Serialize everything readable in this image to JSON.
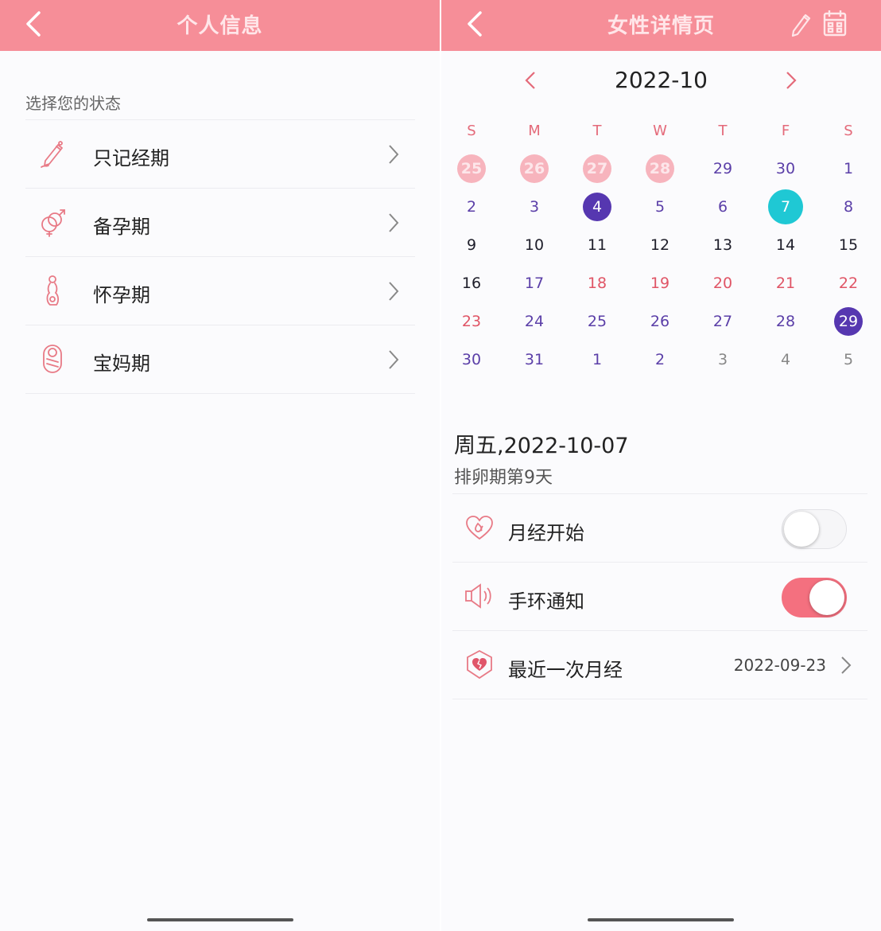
{
  "left": {
    "title": "个人信息",
    "section_label": "选择您的状态",
    "items": [
      {
        "label": "只记经期",
        "icon": "pencil-icon"
      },
      {
        "label": "备孕期",
        "icon": "gender-rings-icon"
      },
      {
        "label": "怀孕期",
        "icon": "pregnant-icon"
      },
      {
        "label": "宝妈期",
        "icon": "baby-icon"
      }
    ]
  },
  "right": {
    "title": "女性详情页",
    "month": "2022-10",
    "weekdays": [
      "S",
      "M",
      "T",
      "W",
      "T",
      "F",
      "S"
    ],
    "weeks": [
      [
        {
          "d": "25",
          "s": "period"
        },
        {
          "d": "26",
          "s": "period"
        },
        {
          "d": "27",
          "s": "period"
        },
        {
          "d": "28",
          "s": "period"
        },
        {
          "d": "29",
          "s": "purple"
        },
        {
          "d": "30",
          "s": "purple"
        },
        {
          "d": "1",
          "s": "purple"
        }
      ],
      [
        {
          "d": "2",
          "s": "purple"
        },
        {
          "d": "3",
          "s": "purple"
        },
        {
          "d": "4",
          "s": "sel-purple"
        },
        {
          "d": "5",
          "s": "purple"
        },
        {
          "d": "6",
          "s": "purple"
        },
        {
          "d": "7",
          "s": "sel-cyan"
        },
        {
          "d": "8",
          "s": "purple"
        }
      ],
      [
        {
          "d": "9",
          "s": "dark"
        },
        {
          "d": "10",
          "s": "dark"
        },
        {
          "d": "11",
          "s": "dark"
        },
        {
          "d": "12",
          "s": "dark"
        },
        {
          "d": "13",
          "s": "dark"
        },
        {
          "d": "14",
          "s": "dark"
        },
        {
          "d": "15",
          "s": "dark"
        }
      ],
      [
        {
          "d": "16",
          "s": "dark"
        },
        {
          "d": "17",
          "s": "purple"
        },
        {
          "d": "18",
          "s": "red"
        },
        {
          "d": "19",
          "s": "red"
        },
        {
          "d": "20",
          "s": "red"
        },
        {
          "d": "21",
          "s": "red"
        },
        {
          "d": "22",
          "s": "red"
        }
      ],
      [
        {
          "d": "23",
          "s": "red"
        },
        {
          "d": "24",
          "s": "purple"
        },
        {
          "d": "25",
          "s": "purple"
        },
        {
          "d": "26",
          "s": "purple"
        },
        {
          "d": "27",
          "s": "purple"
        },
        {
          "d": "28",
          "s": "purple"
        },
        {
          "d": "29",
          "s": "sel-purple"
        }
      ],
      [
        {
          "d": "30",
          "s": "purple"
        },
        {
          "d": "31",
          "s": "purple"
        },
        {
          "d": "1",
          "s": "purple"
        },
        {
          "d": "2",
          "s": "purple"
        },
        {
          "d": "3",
          "s": "grey"
        },
        {
          "d": "4",
          "s": "grey"
        },
        {
          "d": "5",
          "s": "grey"
        }
      ]
    ],
    "selected_date": "周五,2022-10-07",
    "selected_phase": "排卵期第9天",
    "options": {
      "period_start": {
        "label": "月经开始",
        "on": false
      },
      "band_notify": {
        "label": "手环通知",
        "on": true
      },
      "last_period": {
        "label": "最近一次月经",
        "value": "2022-09-23"
      }
    }
  },
  "colors": {
    "header": "#f68e98",
    "accent_pink": "#f4707f",
    "selected_purple": "#5637b0",
    "today_cyan": "#1fc8d4",
    "period_pink": "#f7b4bd"
  }
}
